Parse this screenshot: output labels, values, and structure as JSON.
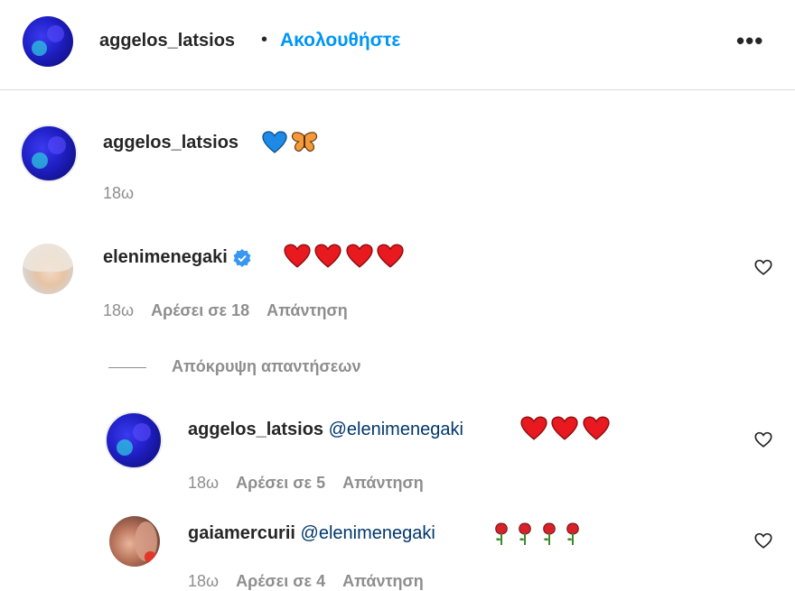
{
  "header": {
    "username": "aggelos_latsios",
    "separator": "•",
    "follow_label": "Ακολουθήστε",
    "more_label": "•••"
  },
  "caption": {
    "username": "aggelos_latsios",
    "emojis": [
      "blue-heart",
      "butterfly"
    ],
    "time": "18ω"
  },
  "comments": [
    {
      "username": "elenimenegaki",
      "verified": true,
      "emojis": [
        "red-heart",
        "red-heart",
        "red-heart",
        "red-heart"
      ],
      "time": "18ω",
      "likes": "Αρέσει σε 18",
      "reply_label": "Απάντηση",
      "hide_replies_label": "Απόκρυψη απαντήσεων",
      "replies": [
        {
          "username": "aggelos_latsios",
          "mention": "@elenimenegaki",
          "emojis": [
            "red-heart",
            "red-heart",
            "red-heart"
          ],
          "time": "18ω",
          "likes": "Αρέσει σε 5",
          "reply_label": "Απάντηση"
        },
        {
          "username": "gaiamercurii",
          "mention": "@elenimenegaki",
          "emojis": [
            "rose",
            "rose",
            "rose",
            "rose"
          ],
          "time": "18ω",
          "likes": "Αρέσει σε 4",
          "reply_label": "Απάντηση"
        }
      ]
    }
  ],
  "colors": {
    "accent": "#0095f6",
    "mention": "#00376b",
    "muted": "#8e8e8e",
    "divider": "#dbdbdb"
  }
}
